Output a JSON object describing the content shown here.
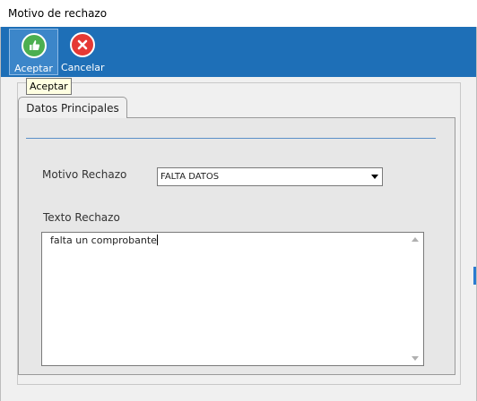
{
  "window": {
    "title": "Motivo de rechazo"
  },
  "toolbar": {
    "accept_label": "Aceptar",
    "cancel_label": "Cancelar",
    "tooltip": "Aceptar",
    "accent": "#1e6fb7"
  },
  "tabs": [
    {
      "label": "Datos Principales"
    }
  ],
  "form": {
    "motivo_label": "Motivo Rechazo",
    "motivo_value": "FALTA DATOS",
    "texto_label": "Texto Rechazo",
    "texto_value": "falta un comprobante"
  }
}
